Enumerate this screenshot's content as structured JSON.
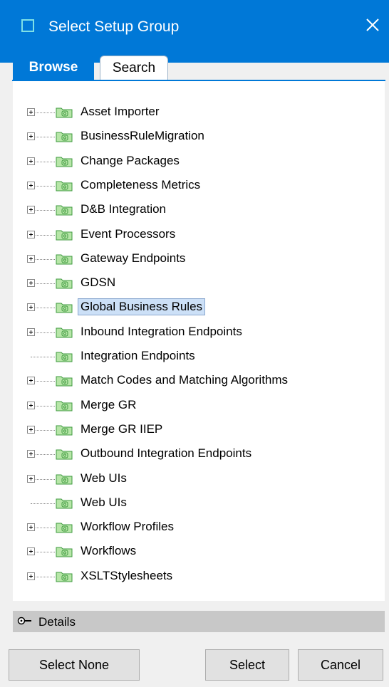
{
  "window": {
    "title": "Select Setup Group",
    "title_icon": "window-icon",
    "close_icon": "close-icon"
  },
  "tabs": [
    {
      "label": "Browse",
      "active": true
    },
    {
      "label": "Search",
      "active": false
    }
  ],
  "tree": {
    "items": [
      {
        "label": "Asset Importer",
        "expandable": true,
        "selected": false
      },
      {
        "label": "BusinessRuleMigration",
        "expandable": true,
        "selected": false
      },
      {
        "label": "Change Packages",
        "expandable": true,
        "selected": false
      },
      {
        "label": "Completeness Metrics",
        "expandable": true,
        "selected": false
      },
      {
        "label": "D&B Integration",
        "expandable": true,
        "selected": false
      },
      {
        "label": "Event Processors",
        "expandable": true,
        "selected": false
      },
      {
        "label": "Gateway Endpoints",
        "expandable": true,
        "selected": false
      },
      {
        "label": "GDSN",
        "expandable": true,
        "selected": false
      },
      {
        "label": "Global Business Rules",
        "expandable": true,
        "selected": true
      },
      {
        "label": "Inbound Integration Endpoints",
        "expandable": true,
        "selected": false
      },
      {
        "label": "Integration Endpoints",
        "expandable": false,
        "selected": false
      },
      {
        "label": "Match Codes and Matching Algorithms",
        "expandable": true,
        "selected": false
      },
      {
        "label": "Merge GR",
        "expandable": true,
        "selected": false
      },
      {
        "label": "Merge GR IIEP",
        "expandable": true,
        "selected": false
      },
      {
        "label": "Outbound Integration Endpoints",
        "expandable": true,
        "selected": false
      },
      {
        "label": "Web UIs",
        "expandable": true,
        "selected": false
      },
      {
        "label": "Web UIs",
        "expandable": false,
        "selected": false
      },
      {
        "label": "Workflow Profiles",
        "expandable": true,
        "selected": false
      },
      {
        "label": "Workflows",
        "expandable": true,
        "selected": false
      },
      {
        "label": "XSLTStylesheets",
        "expandable": true,
        "selected": false
      }
    ],
    "folder_icon": "setup-group-folder-icon",
    "colors": {
      "folder_fill": "#b7e6a8",
      "folder_stroke": "#3f9a3f",
      "selection": "#cce0f7"
    }
  },
  "details": {
    "label": "Details",
    "icon": "expand-toggle-icon"
  },
  "buttons": {
    "select_none": "Select None",
    "select": "Select",
    "cancel": "Cancel"
  },
  "colors": {
    "accent": "#0078d7",
    "background": "#f0f0f0",
    "details_bar": "#c8c8c8"
  }
}
